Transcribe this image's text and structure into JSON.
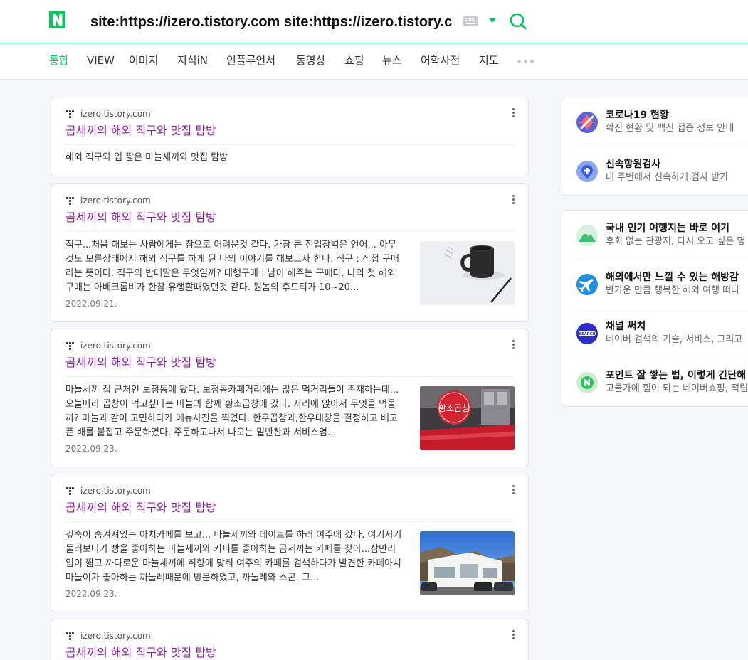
{
  "brand": {
    "logo_letter": "N",
    "accent": "#03c75a",
    "visited_link_color": "#8c1da8"
  },
  "search": {
    "query": "site:https://izero.tistory.com site:https://izero.tistory.com"
  },
  "tabs": [
    {
      "label": "통합",
      "active": true
    },
    {
      "label": "VIEW"
    },
    {
      "label": "이미지"
    },
    {
      "label": "지식iN"
    },
    {
      "label": "인플루언서"
    },
    {
      "label": "동영상"
    },
    {
      "label": "쇼핑"
    },
    {
      "label": "뉴스"
    },
    {
      "label": "어학사전"
    },
    {
      "label": "지도"
    }
  ],
  "results": [
    {
      "source": "izero.tistory.com",
      "title": "곰세끼의 해외 직구와 맛집 탐방",
      "description": "해외 직구와 입 짧은 마늘세끼와 맛집 탐방"
    },
    {
      "source": "izero.tistory.com",
      "title": "곰세끼의 해외 직구와 맛집 탐방",
      "description": "직구...처음 해보는 사람에게는 참으로 어려운것 같다. 가장 큰 진입장벽은 언어... 아무것도 모른상태에서 해외 직구를 하게 된 나의 이야기를 해보고자 한다. 직구 : 직접 구매라는 뜻이다. 직구의 반대말은 무엇일까? 대행구매 : 남이 해주는 구매다. 나의 첫 해외 구매는 아베크롬비가 한참 유행할때였던것 같다. 뭔놈의 후드티가 10~20...",
      "date": "2022.09.21.",
      "thumb": "coffee-mug"
    },
    {
      "source": "izero.tistory.com",
      "title": "곰세끼의 해외 직구와 맛집 탐방",
      "description": "마늘세끼 집 근처인 보정동에 왔다. 보정동카페거리에는 많은 먹거리들이 존재하는데... 오늘따라 곱창이 먹고싶다는 마늘과 함께 황소곱창에 갔다. 자리에 앉아서 무엇을 먹을까? 마늘과 같이 고민하다가 메뉴사진을 찍었다. 한우곱창과,한우대창을 결정하고 배고픈 배를 붙잡고 주문하였다. 주문하고나서 나오는 밑반찬과 서비스염...",
      "date": "2022.09.23.",
      "thumb": "restaurant-sign",
      "thumb_sign_text": "황소곱창"
    },
    {
      "source": "izero.tistory.com",
      "title": "곰세끼의 해외 직구와 맛집 탐방",
      "description": "깊숙이 숨겨져있는 아치카페를 보고... 마늘세끼와 데이트를 하러 여주에 갔다. 여기저기 둘러보다가 빵을 좋아하는 마늘세끼와 커피를 좋아하는 곰세끼는 카페를 찾아...삼만리 입이 짧고 까다로운 마늘세끼에 취향에 맞춰 여주의 카페를 검색하다가 발견한 카페아치 마늘이가 좋아하는 까눌레때문에 방문하였고, 까눌레와 스콘, 그...",
      "date": "2022.09.23.",
      "thumb": "cafe-building"
    },
    {
      "source": "izero.tistory.com",
      "title": "곰세끼의 해외 직구와 맛집 탐방"
    }
  ],
  "side_panels": [
    {
      "items": [
        {
          "icon": "covid-icon",
          "title": "코로나19 현황",
          "subtitle": "확진 현황 및 백신 접종 정보 안내"
        },
        {
          "icon": "test-location-icon",
          "title": "신속항원검사",
          "subtitle": "내 주변에서 신속하게 검사 받기"
        }
      ]
    },
    {
      "items": [
        {
          "icon": "mountain-icon",
          "title": "국내 인기 여행지는 바로 여기",
          "subtitle": "후회 없는 관광지, 다시 오고 싶은 명"
        },
        {
          "icon": "airplane-icon",
          "title": "해외에서만 느낄 수 있는 해방감",
          "subtitle": "반가운 만큼 행복한 해외 여행 떠나"
        },
        {
          "icon": "search-channel-icon",
          "title": "채널 써치",
          "subtitle": "네이버 검색의 기술, 서비스, 그리고",
          "icon_text": "SEARCH"
        },
        {
          "icon": "naver-point-icon",
          "title": "포인트 잘 쌓는 법, 이렇게 간단해",
          "subtitle": "고물가에 힘이 되는 네이버쇼핑, 적립"
        }
      ]
    }
  ]
}
